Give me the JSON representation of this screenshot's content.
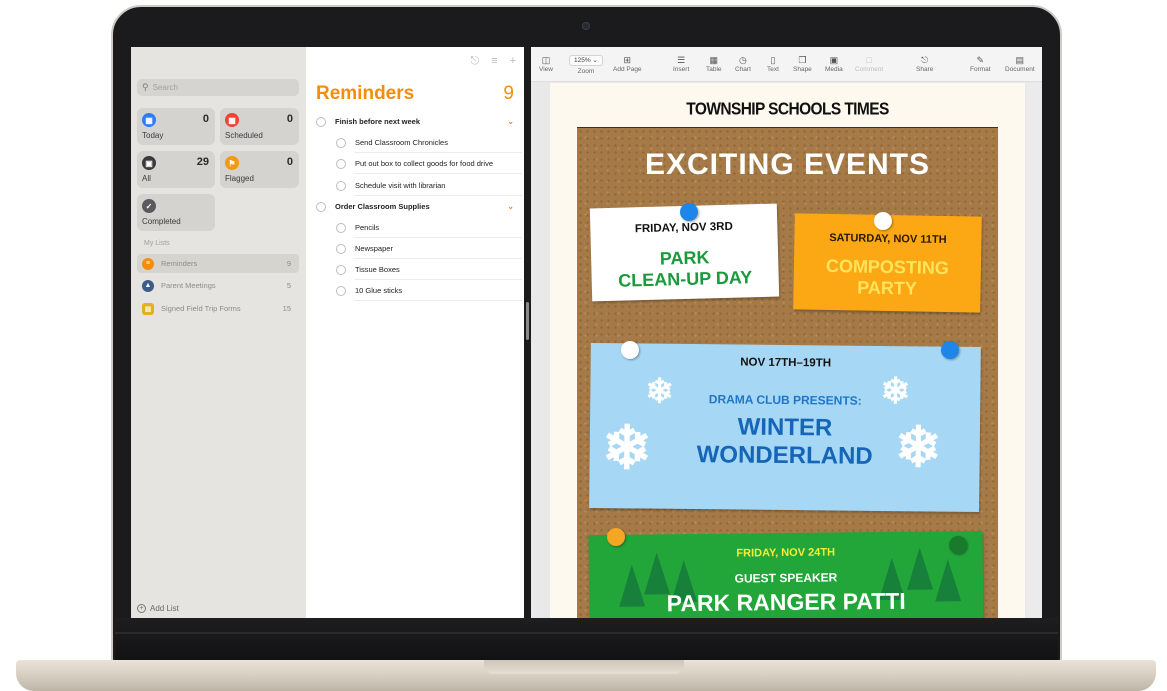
{
  "sidebar": {
    "search_placeholder": "Search",
    "smart_lists": [
      {
        "label": "Today",
        "count": "0",
        "color": "#2f7cf6",
        "icon": "calendar-icon"
      },
      {
        "label": "Scheduled",
        "count": "0",
        "color": "#f0433a",
        "icon": "calendar-icon"
      },
      {
        "label": "All",
        "count": "29",
        "color": "#3a3a3c",
        "icon": "tray-icon"
      },
      {
        "label": "Flagged",
        "count": "0",
        "color": "#f59a0d",
        "icon": "flag-icon"
      },
      {
        "label": "Completed",
        "count": "",
        "color": "#5a5a5e",
        "icon": "checkmark-icon"
      }
    ],
    "my_lists_heading": "My Lists",
    "lists": [
      {
        "name": "Reminders",
        "count": "9",
        "color": "#f58c0a",
        "icon": "list-icon"
      },
      {
        "name": "Parent Meetings",
        "count": "5",
        "color": "#3c5a8a",
        "icon": "graduation-cap-icon"
      },
      {
        "name": "Signed Field Trip Forms",
        "count": "15",
        "color": "#e0b21e",
        "icon": "bus-icon"
      }
    ],
    "add_list": "Add List"
  },
  "reminders": {
    "title": "Reminders",
    "count": "9",
    "groups": [
      {
        "title": "Finish before next week",
        "items": [
          "Send Classroom Chronicles",
          "Put out box to collect goods for food drive",
          "Schedule visit with librarian"
        ]
      },
      {
        "title": "Order Classroom Supplies",
        "items": [
          "Pencils",
          "Newspaper",
          "Tissue Boxes",
          "10 Glue sticks"
        ]
      }
    ]
  },
  "pages_toolbar": {
    "zoom_value": "125%",
    "buttons": [
      {
        "label": "View",
        "icon": "sidebar-icon"
      },
      {
        "label": "Zoom",
        "icon": "zoom-icon"
      },
      {
        "label": "Add Page",
        "icon": "add-page-icon"
      },
      {
        "label": "Insert",
        "icon": "insert-icon"
      },
      {
        "label": "Table",
        "icon": "table-icon"
      },
      {
        "label": "Chart",
        "icon": "chart-icon"
      },
      {
        "label": "Text",
        "icon": "text-icon"
      },
      {
        "label": "Shape",
        "icon": "shape-icon"
      },
      {
        "label": "Media",
        "icon": "media-icon"
      },
      {
        "label": "Comment",
        "icon": "comment-icon"
      },
      {
        "label": "Share",
        "icon": "share-icon"
      },
      {
        "label": "Format",
        "icon": "format-brush-icon"
      },
      {
        "label": "Document",
        "icon": "document-icon"
      }
    ]
  },
  "newsletter": {
    "masthead": "TOWNSHIP SCHOOLS TIMES",
    "heading": "EXCITING EVENTS",
    "events": [
      {
        "date": "FRIDAY, NOV 3RD",
        "line1": "PARK",
        "line2": "CLEAN-UP DAY"
      },
      {
        "date": "SATURDAY, NOV 11TH",
        "line1": "COMPOSTING",
        "line2": "PARTY"
      },
      {
        "date": "NOV 17TH–19TH",
        "subtitle": "DRAMA CLUB PRESENTS:",
        "line1": "WINTER",
        "line2": "WONDERLAND"
      },
      {
        "date": "FRIDAY, NOV 24TH",
        "subtitle": "GUEST SPEAKER",
        "line1": "PARK RANGER PATTI"
      }
    ]
  },
  "colors": {
    "accent_orange": "#f58c0a",
    "pin_blue": "#1e86e8",
    "pin_white": "#ffffff",
    "pin_green": "#1a7a2c",
    "pin_orange": "#f5a623"
  }
}
